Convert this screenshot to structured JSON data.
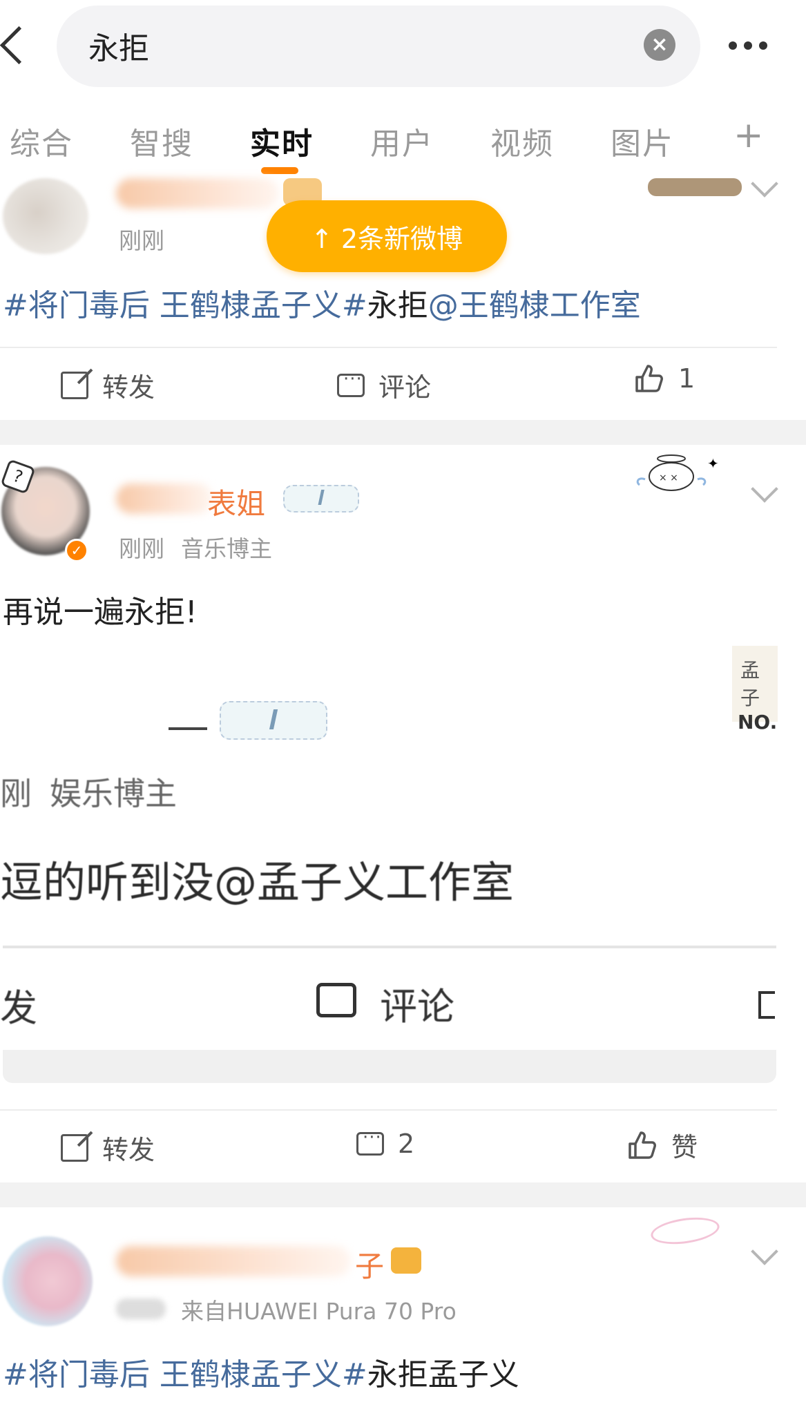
{
  "search": {
    "query": "永拒"
  },
  "tabs": [
    {
      "label": "综合"
    },
    {
      "label": "智搜"
    },
    {
      "label": "实时"
    },
    {
      "label": "用户"
    },
    {
      "label": "视频"
    },
    {
      "label": "图片"
    },
    {
      "label": "+"
    }
  ],
  "banner": {
    "label": "↑  2条新微博"
  },
  "post1": {
    "time": "刚刚",
    "topic": "#将门毒后 王鹤棣孟子义#",
    "text": "永拒",
    "mention": "@王鹤棣工作室",
    "repost_label": "转发",
    "comment_label": "评论",
    "like_count": "1"
  },
  "post2": {
    "name_visible": "表姐",
    "time": "刚刚",
    "tag": "音乐博主",
    "text": "再说一遍永拒!",
    "embed": {
      "side_label_1": "孟子",
      "side_label_2": "NO.",
      "meta_time": "刚",
      "meta_tag": "娱乐博主",
      "big_text": "逗的听到没@孟子义工作室",
      "repost_label": "发",
      "comment_label": "评论"
    },
    "repost_label": "转发",
    "comment_count": "2",
    "like_label": "赞"
  },
  "post3": {
    "name_visible": "子",
    "time": "刚刚",
    "source": "来自HUAWEI Pura 70 Pro",
    "topic": "#将门毒后 王鹤棣孟子义#",
    "text": "永拒孟子义"
  },
  "colors": {
    "accent": "#ff8200",
    "banner": "#ffb000",
    "topic": "#466b9c",
    "name_orange": "#f07b3f"
  }
}
